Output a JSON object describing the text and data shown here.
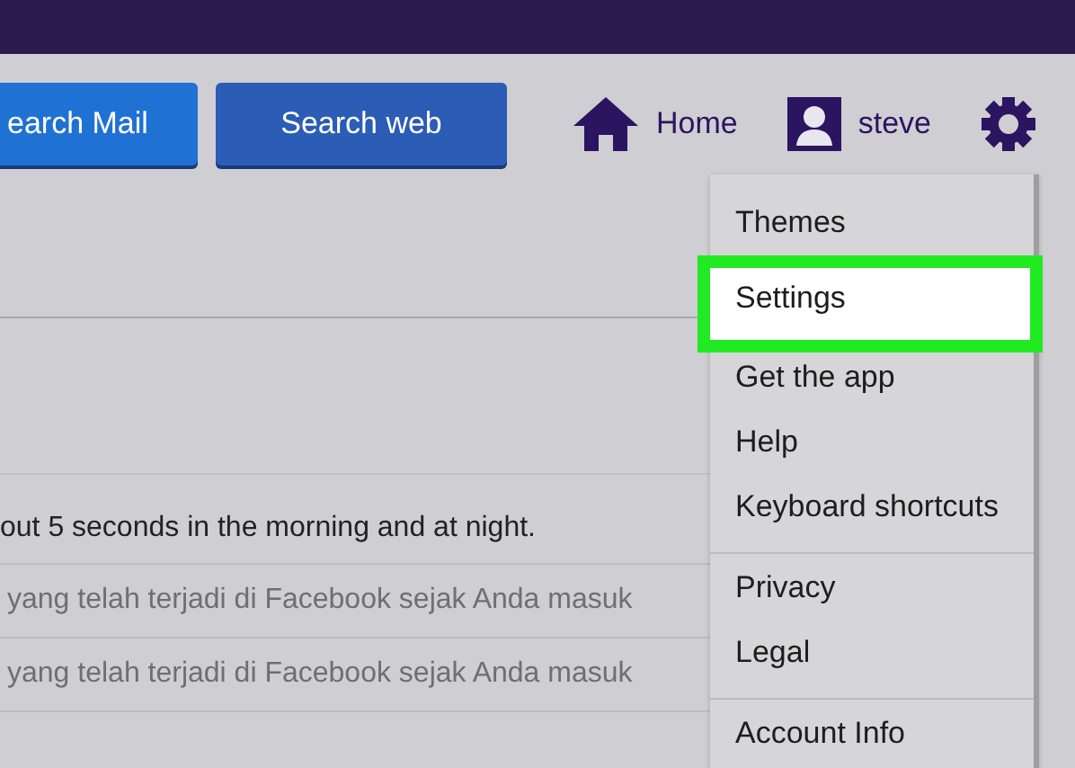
{
  "header": {
    "buttons": [
      {
        "label": "earch Mail",
        "kind": "mail"
      },
      {
        "label": "Search web",
        "kind": "web"
      }
    ],
    "home": {
      "label": "Home"
    },
    "user": {
      "label": "steve"
    }
  },
  "messages": [
    {
      "text": "out 5 seconds in the morning and at night.",
      "read": false
    },
    {
      "text": "yang telah terjadi di Facebook sejak Anda masuk",
      "read": true
    },
    {
      "text": "yang telah terjadi di Facebook sejak Anda masuk",
      "read": true
    }
  ],
  "menu": {
    "groups": [
      [
        {
          "label": "Themes",
          "highlighted": false
        },
        {
          "label": "Settings",
          "highlighted": true
        },
        {
          "label": "Get the app",
          "highlighted": false
        },
        {
          "label": "Help",
          "highlighted": false
        },
        {
          "label": "Keyboard shortcuts",
          "highlighted": false
        }
      ],
      [
        {
          "label": "Privacy",
          "highlighted": false
        },
        {
          "label": "Legal",
          "highlighted": false
        }
      ],
      [
        {
          "label": "Account Info",
          "highlighted": false
        }
      ]
    ]
  }
}
